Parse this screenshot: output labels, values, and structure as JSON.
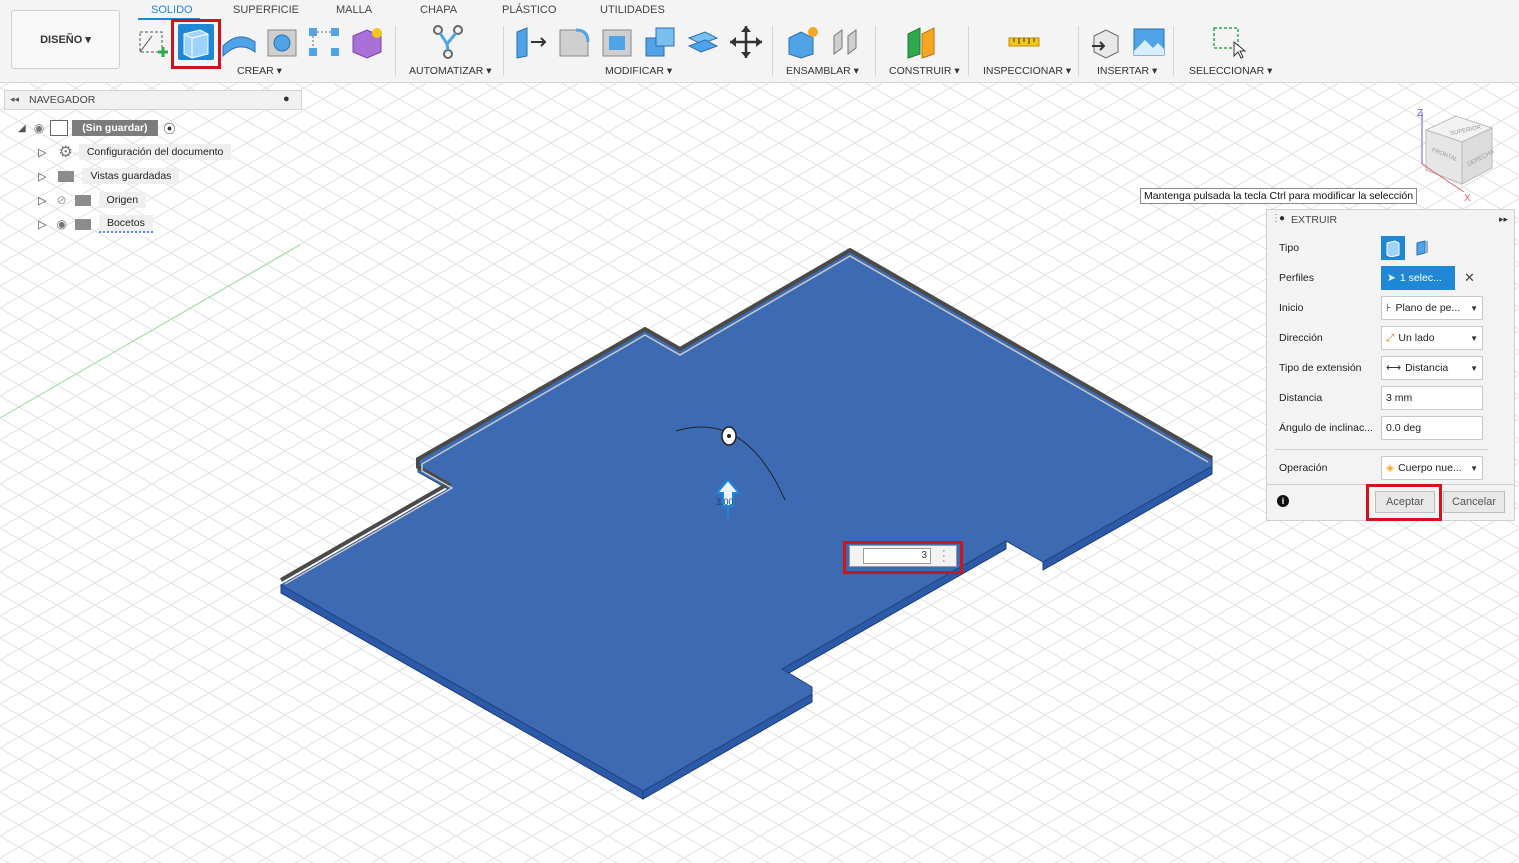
{
  "toolbar": {
    "design_label": "DISEÑO ▾",
    "tabs": [
      "SOLIDO",
      "SUPERFICIE",
      "MALLA",
      "CHAPA",
      "PLÁSTICO",
      "UTILIDADES"
    ],
    "groups": [
      "CREAR ▾",
      "AUTOMATIZAR ▾",
      "MODIFICAR ▾",
      "ENSAMBLAR ▾",
      "CONSTRUIR ▾",
      "INSPECCIONAR ▾",
      "INSERTAR ▾",
      "SELECCIONAR ▾"
    ],
    "annotation": "Extruir"
  },
  "browser": {
    "title": "NAVEGADOR",
    "items": [
      "(Sin guardar)",
      "Configuración del documento",
      "Vistas guardadas",
      "Origen",
      "Bocetos"
    ]
  },
  "tooltip": "Mantenga pulsada la tecla Ctrl para modificar la selección",
  "viewcube": {
    "faces": [
      "SUPERIOR",
      "FRONTAL",
      "DERECHA"
    ],
    "axes": [
      "Z",
      "X"
    ]
  },
  "panel": {
    "title": "EXTRUIR",
    "rows": {
      "tipo": "Tipo",
      "perfiles": "Perfiles",
      "perfiles_value": "1 selec...",
      "inicio": "Inicio",
      "inicio_value": "Plano de pe...",
      "direccion": "Dirección",
      "direccion_value": "Un lado",
      "tipo_extension": "Tipo de extensión",
      "tipo_extension_value": "Distancia",
      "distancia": "Distancia",
      "distancia_value": "3 mm",
      "angulo": "Ángulo de inclinac...",
      "angulo_value": "0.0 deg",
      "operacion": "Operación",
      "operacion_value": "Cuerpo nue..."
    },
    "accept": "Aceptar",
    "cancel": "Cancelar"
  },
  "canvas": {
    "distance_input": "3",
    "manipulator_label": "3.00"
  },
  "colors": {
    "accent": "#1e88d6",
    "body_top": "#3d6bb3",
    "body_side": "#2f5cae",
    "highlight": "#d0141c"
  }
}
